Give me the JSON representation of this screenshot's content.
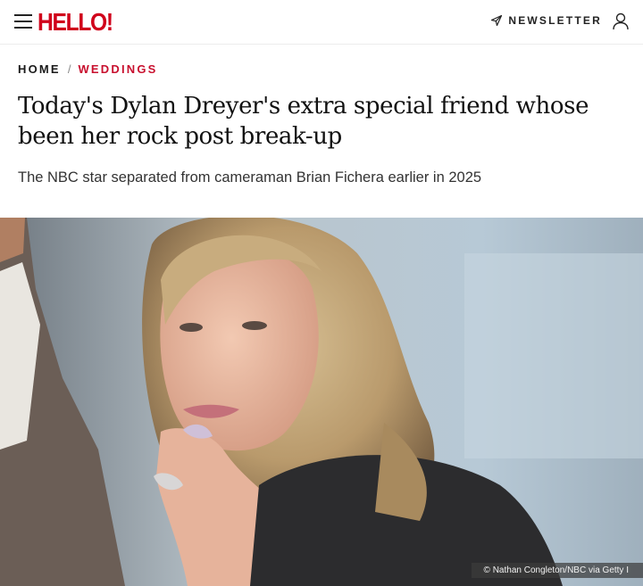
{
  "header": {
    "logo_text": "HELLO!",
    "brand_color": "#d0021b",
    "newsletter_label": "NEWSLETTER",
    "menu_icon": "hamburger-icon",
    "newsletter_icon": "send-icon",
    "account_icon": "user-icon"
  },
  "breadcrumb": {
    "home": "HOME",
    "separator": "/",
    "category": "WEDDINGS",
    "category_color": "#c8102e"
  },
  "article": {
    "headline": "Today's Dylan Dreyer's extra special friend whose been her rock post break-up",
    "subheadline": "The NBC star separated from cameraman Brian Fichera earlier in 2025",
    "image_credit": "© Nathan Congleton/NBC via Getty I"
  }
}
